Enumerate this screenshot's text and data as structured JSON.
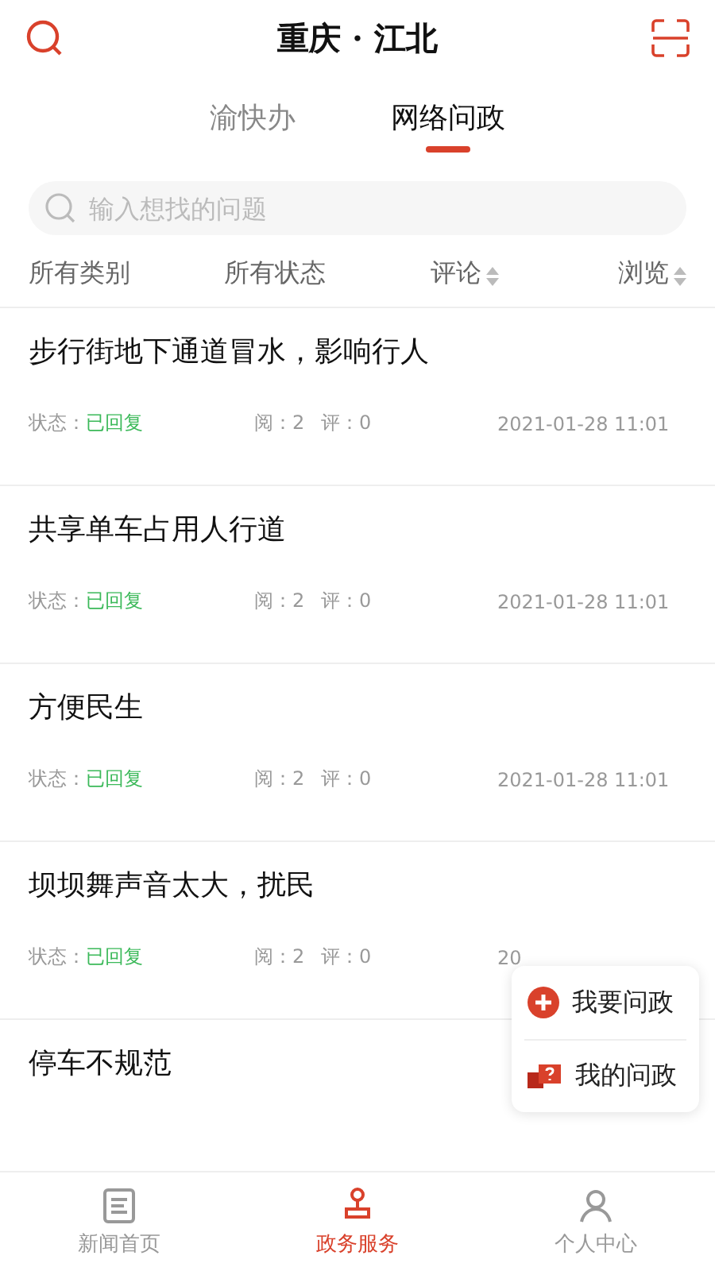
{
  "header": {
    "title": "重庆 · 江北"
  },
  "tabs": [
    {
      "label": "渝快办",
      "selected": false
    },
    {
      "label": "网络问政",
      "selected": true
    }
  ],
  "search": {
    "placeholder": "输入想找的问题"
  },
  "filters": [
    {
      "label": "所有类别",
      "sortable": false
    },
    {
      "label": "所有状态",
      "sortable": false
    },
    {
      "label": "评论",
      "sortable": true
    },
    {
      "label": "浏览",
      "sortable": true
    }
  ],
  "posts": [
    {
      "title": "步行街地下通道冒水，影响行人",
      "status_label": "状态：",
      "status": "已回复",
      "views": "阅：2",
      "comments": "评：0",
      "time": "2021-01-28  11:01"
    },
    {
      "title": "共享单车占用人行道",
      "status_label": "状态：",
      "status": "已回复",
      "views": "阅：2",
      "comments": "评：0",
      "time": "2021-01-28  11:01"
    },
    {
      "title": "方便民生",
      "status_label": "状态：",
      "status": "已回复",
      "views": "阅：2",
      "comments": "评：0",
      "time": "2021-01-28  11:01"
    },
    {
      "title": "坝坝舞声音太大，扰民",
      "status_label": "状态：",
      "status": "已回复",
      "views": "阅：2",
      "comments": "评：0",
      "time": "20"
    },
    {
      "title": "停车不规范"
    }
  ],
  "floating_menu": [
    {
      "kind": "add",
      "label": "我要问政"
    },
    {
      "kind": "mine",
      "label": "我的问政"
    }
  ],
  "bottom_nav": [
    {
      "kind": "news",
      "label": "新闻首页",
      "selected": false
    },
    {
      "kind": "service",
      "label": "政务服务",
      "selected": true
    },
    {
      "kind": "person",
      "label": "个人中心",
      "selected": false
    }
  ]
}
